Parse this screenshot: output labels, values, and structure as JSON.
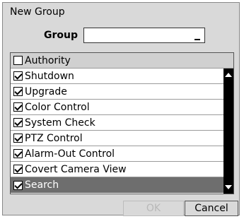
{
  "dialog": {
    "title": "New Group"
  },
  "group": {
    "label": "Group",
    "value": ""
  },
  "list": {
    "header": {
      "label": "Authority",
      "checked": false
    },
    "items": [
      {
        "label": "Shutdown",
        "checked": true
      },
      {
        "label": "Upgrade",
        "checked": true
      },
      {
        "label": "Color Control",
        "checked": true
      },
      {
        "label": "System Check",
        "checked": true
      },
      {
        "label": "PTZ Control",
        "checked": true
      },
      {
        "label": "Alarm-Out Control",
        "checked": true
      },
      {
        "label": "Covert Camera View",
        "checked": true
      },
      {
        "label": "Search",
        "checked": true,
        "selected": true
      }
    ]
  },
  "buttons": {
    "ok": "OK",
    "cancel": "Cancel"
  }
}
